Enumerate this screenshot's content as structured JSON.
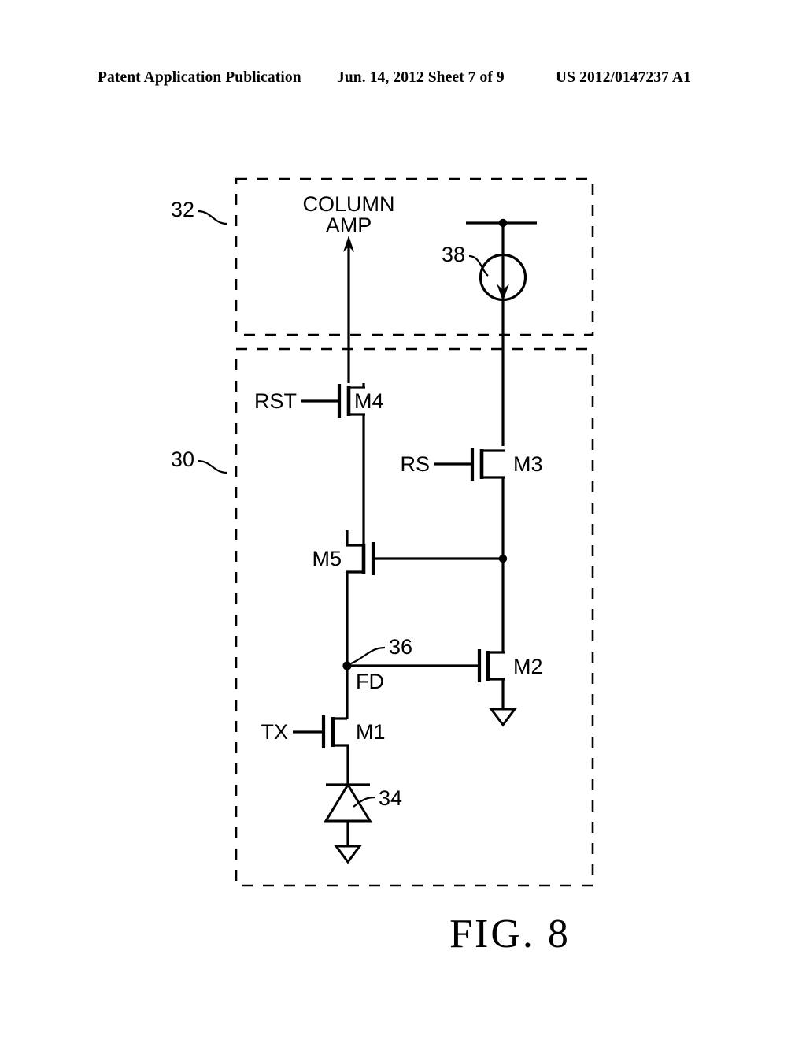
{
  "header": {
    "publication": "Patent Application Publication",
    "date_sheet": "Jun. 14, 2012  Sheet 7 of 9",
    "patent_number": "US 2012/0147237 A1"
  },
  "figure": {
    "caption": "FIG. 8",
    "blocks": [
      {
        "ref": "32",
        "role": "column-readout-block"
      },
      {
        "ref": "30",
        "role": "pixel-block"
      }
    ],
    "labels": {
      "column_amp_line1": "COLUMN",
      "column_amp_line2": "AMP",
      "fd_node": "FD"
    },
    "reference_numerals": {
      "readout_block": "32",
      "pixel_block": "30",
      "photodiode": "34",
      "floating_diffusion": "36",
      "current_source": "38"
    },
    "transistors": [
      {
        "name": "M1",
        "gate_signal": "TX"
      },
      {
        "name": "M2",
        "gate_signal": ""
      },
      {
        "name": "M3",
        "gate_signal": "RS"
      },
      {
        "name": "M4",
        "gate_signal": "RST"
      },
      {
        "name": "M5",
        "gate_signal": ""
      }
    ],
    "signals": {
      "reset": "RST",
      "row_select": "RS",
      "transfer": "TX"
    },
    "colors": {
      "ink": "#000000",
      "background": "#ffffff"
    }
  }
}
